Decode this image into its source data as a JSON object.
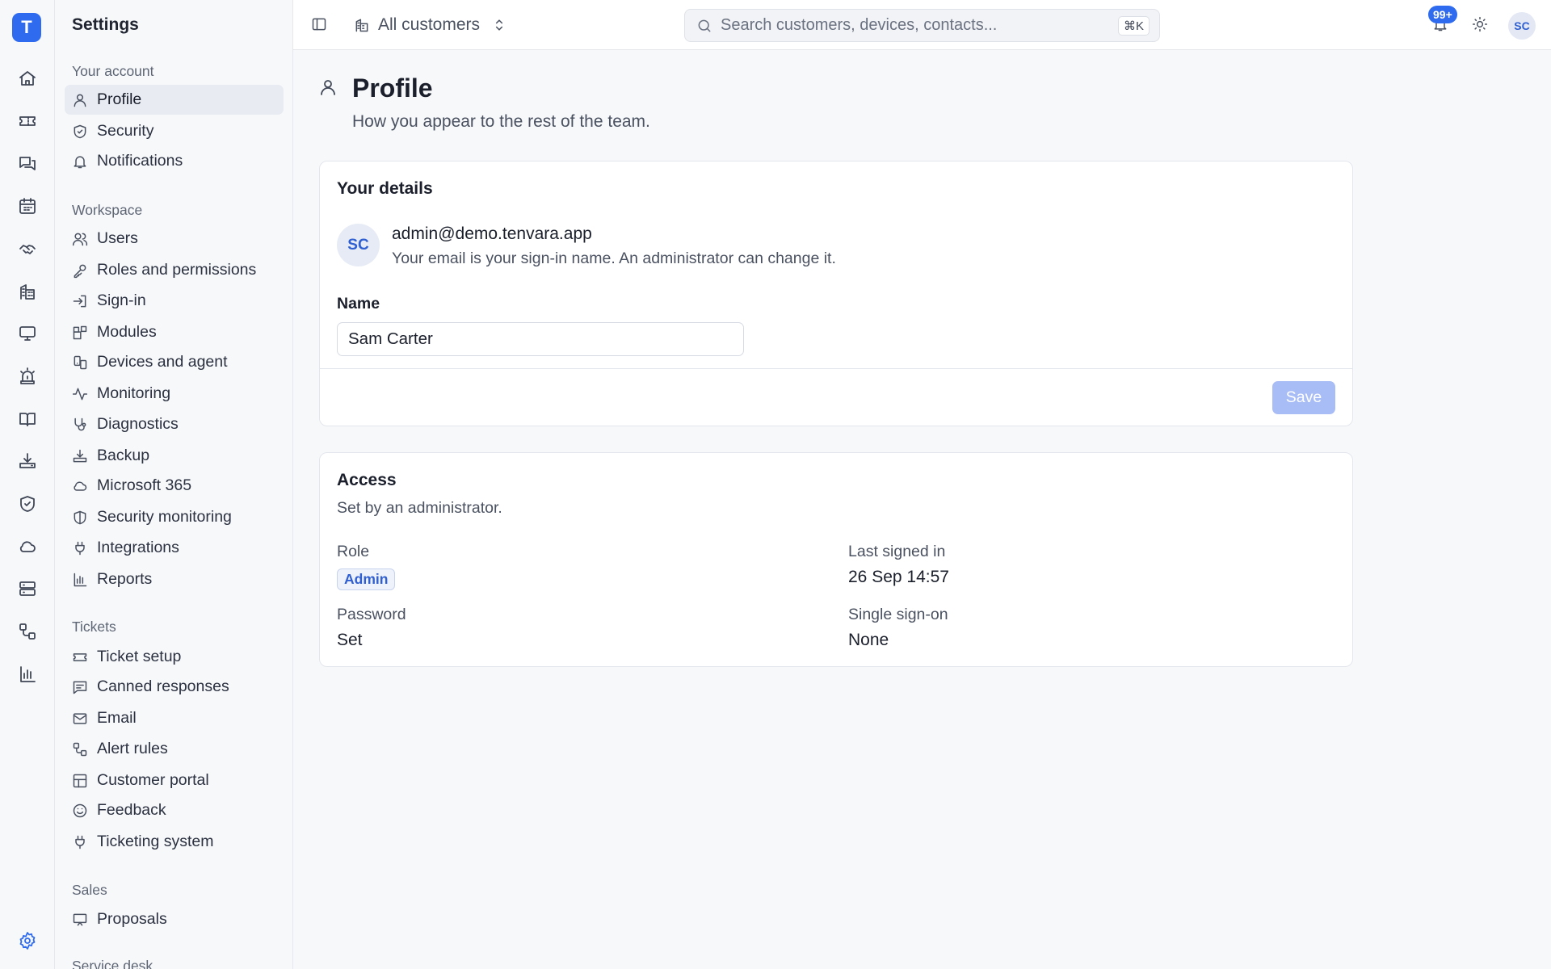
{
  "app": {
    "logo_letter": "T",
    "accent_color": "#2f6bef"
  },
  "rail": {
    "items": [
      {
        "name": "home-icon"
      },
      {
        "name": "ticket-icon"
      },
      {
        "name": "chat-icon"
      },
      {
        "name": "calendar-icon"
      },
      {
        "name": "handshake-icon"
      },
      {
        "name": "building-icon"
      },
      {
        "name": "monitor-icon"
      },
      {
        "name": "siren-icon"
      },
      {
        "name": "book-icon"
      },
      {
        "name": "download-tray-icon"
      },
      {
        "name": "shield-check-icon"
      },
      {
        "name": "cloud-icon"
      },
      {
        "name": "server-icon"
      },
      {
        "name": "workflow-icon"
      },
      {
        "name": "bar-chart-icon"
      }
    ],
    "settings_icon": "gear-icon"
  },
  "settings_nav": {
    "title": "Settings",
    "groups": {
      "your_account": {
        "label": "Your account",
        "items": [
          "Profile",
          "Security",
          "Notifications"
        ]
      },
      "workspace": {
        "label": "Workspace",
        "items": [
          "Users",
          "Roles and permissions",
          "Sign-in",
          "Modules",
          "Devices and agent",
          "Monitoring",
          "Diagnostics",
          "Backup",
          "Microsoft 365",
          "Security monitoring",
          "Integrations",
          "Reports"
        ]
      },
      "tickets": {
        "label": "Tickets",
        "items": [
          "Ticket setup",
          "Canned responses",
          "Email",
          "Alert rules",
          "Customer portal",
          "Feedback",
          "Ticketing system"
        ]
      },
      "sales": {
        "label": "Sales",
        "items": [
          "Proposals"
        ]
      },
      "service_desk": {
        "label": "Service desk"
      }
    },
    "active_item": "Profile"
  },
  "topbar": {
    "customer_switch_label": "All customers",
    "search_placeholder": "Search customers, devices, contacts...",
    "search_shortcut": "⌘K",
    "notifications_badge": "99+",
    "avatar_initials": "SC"
  },
  "page": {
    "title": "Profile",
    "subtitle": "How you appear to the rest of the team."
  },
  "details_card": {
    "title": "Your details",
    "avatar_initials": "SC",
    "email": "admin@demo.tenvara.app",
    "note": "Your email is your sign-in name. An administrator can change it.",
    "name_label": "Name",
    "name_value": "Sam Carter",
    "save_label": "Save"
  },
  "access_card": {
    "title": "Access",
    "subtitle": "Set by an administrator.",
    "role_label": "Role",
    "role_value": "Admin",
    "last_signed_in_label": "Last signed in",
    "last_signed_in_value": "26 Sep 14:57",
    "password_label": "Password",
    "password_value": "Set",
    "sso_label": "Single sign-on",
    "sso_value": "None"
  }
}
